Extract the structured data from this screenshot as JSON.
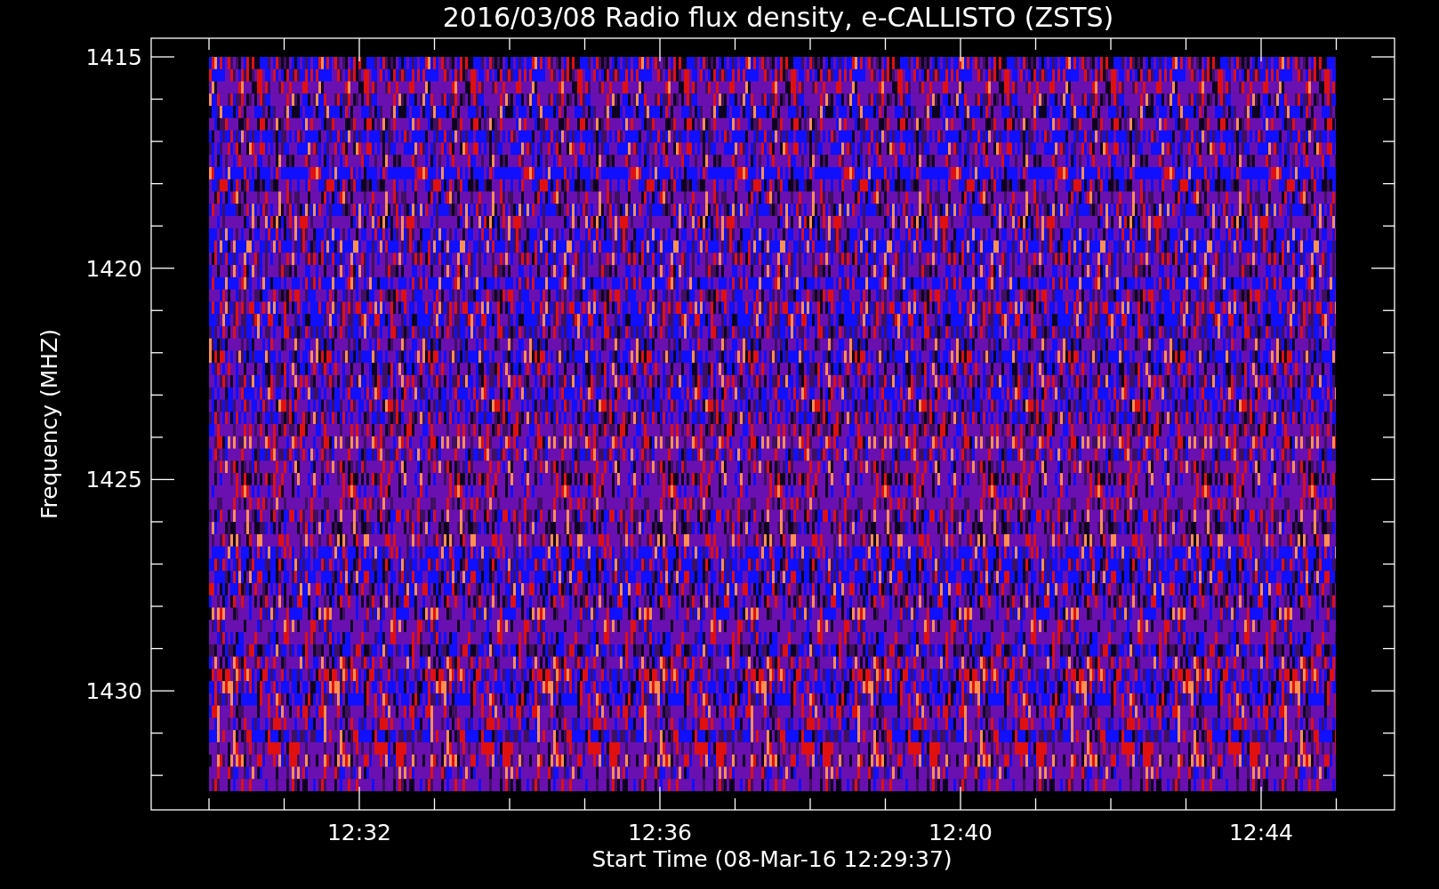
{
  "plot": {
    "title": "2016/03/08  Radio flux density, e-CALLISTO (ZSTS)",
    "x_axis": {
      "label": "Start Time (08-Mar-16 12:29:37)",
      "ticks": [
        "12:32",
        "12:36",
        "12:40",
        "12:44"
      ]
    },
    "y_axis": {
      "label": "Frequency (MHZ)",
      "ticks": [
        "1415",
        "1420",
        "1425",
        "1430"
      ]
    }
  }
}
